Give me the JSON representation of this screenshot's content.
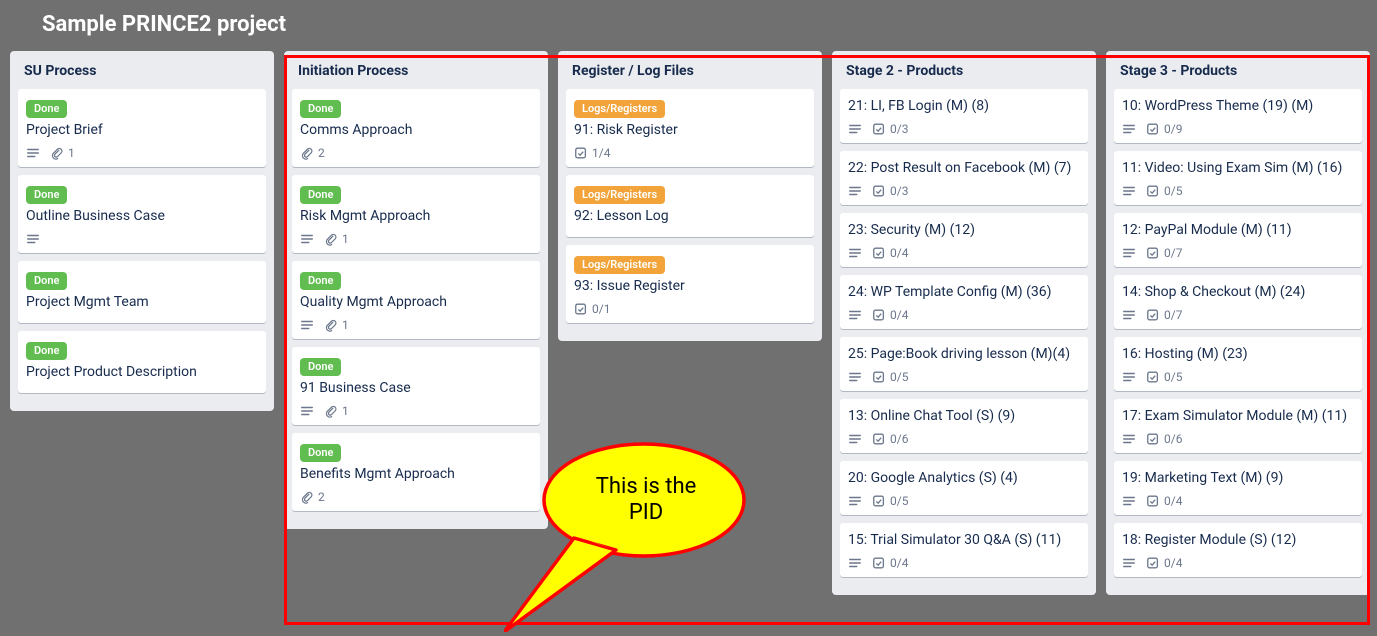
{
  "page_title": "Sample PRINCE2 project",
  "labels": {
    "done": "Done",
    "logs": "Logs/Registers"
  },
  "callout_text": "This is the PID",
  "lists": [
    {
      "title": "SU Process",
      "cards": [
        {
          "label": "done",
          "title": "Project Brief",
          "desc": true,
          "attach": "1"
        },
        {
          "label": "done",
          "title": "Outline Business Case",
          "desc": true
        },
        {
          "label": "done",
          "title": "Project Mgmt Team"
        },
        {
          "label": "done",
          "title": "Project Product Description"
        }
      ]
    },
    {
      "title": "Initiation Process",
      "cards": [
        {
          "label": "done",
          "title": "Comms Approach",
          "attach": "2"
        },
        {
          "label": "done",
          "title": "Risk Mgmt Approach",
          "desc": true,
          "attach": "1"
        },
        {
          "label": "done",
          "title": "Quality Mgmt Approach",
          "desc": true,
          "attach": "1"
        },
        {
          "label": "done",
          "title": "91 Business Case",
          "desc": true,
          "attach": "1"
        },
        {
          "label": "done",
          "title": "Benefits Mgmt Approach",
          "attach": "2"
        }
      ]
    },
    {
      "title": "Register / Log Files",
      "cards": [
        {
          "label": "logs",
          "title": "91: Risk Register",
          "check": "1/4"
        },
        {
          "label": "logs",
          "title": "92: Lesson Log"
        },
        {
          "label": "logs",
          "title": "93: Issue Register",
          "check": "0/1"
        }
      ]
    },
    {
      "title": "Stage 2 - Products",
      "cards": [
        {
          "title": "21: LI, FB Login (M) (8)",
          "desc": true,
          "check": "0/3"
        },
        {
          "title": "22: Post Result on Facebook (M) (7)",
          "desc": true,
          "check": "0/3"
        },
        {
          "title": "23: Security (M) (12)",
          "desc": true,
          "check": "0/4"
        },
        {
          "title": "24: WP Template Config (M) (36)",
          "desc": true,
          "check": "0/4"
        },
        {
          "title": "25: Page:Book driving lesson (M)(4)",
          "desc": true,
          "check": "0/5"
        },
        {
          "title": "13: Online Chat Tool (S) (9)",
          "desc": true,
          "check": "0/6"
        },
        {
          "title": "20: Google Analytics (S) (4)",
          "desc": true,
          "check": "0/5"
        },
        {
          "title": "15: Trial Simulator 30 Q&A (S) (11)",
          "desc": true,
          "check": "0/4"
        }
      ]
    },
    {
      "title": "Stage 3 - Products",
      "cards": [
        {
          "title": "10: WordPress Theme (19) (M)",
          "desc": true,
          "check": "0/9"
        },
        {
          "title": "11: Video: Using Exam Sim (M) (16)",
          "desc": true,
          "check": "0/5"
        },
        {
          "title": "12: PayPal Module (M) (11)",
          "desc": true,
          "check": "0/7"
        },
        {
          "title": "14: Shop & Checkout (M) (24)",
          "desc": true,
          "check": "0/7"
        },
        {
          "title": "16: Hosting (M) (23)",
          "desc": true,
          "check": "0/5"
        },
        {
          "title": "17: Exam Simulator Module (M) (11)",
          "desc": true,
          "check": "0/6"
        },
        {
          "title": "19: Marketing Text (M) (9)",
          "desc": true,
          "check": "0/4"
        },
        {
          "title": "18: Register Module (S) (12)",
          "desc": true,
          "check": "0/4"
        }
      ]
    }
  ]
}
